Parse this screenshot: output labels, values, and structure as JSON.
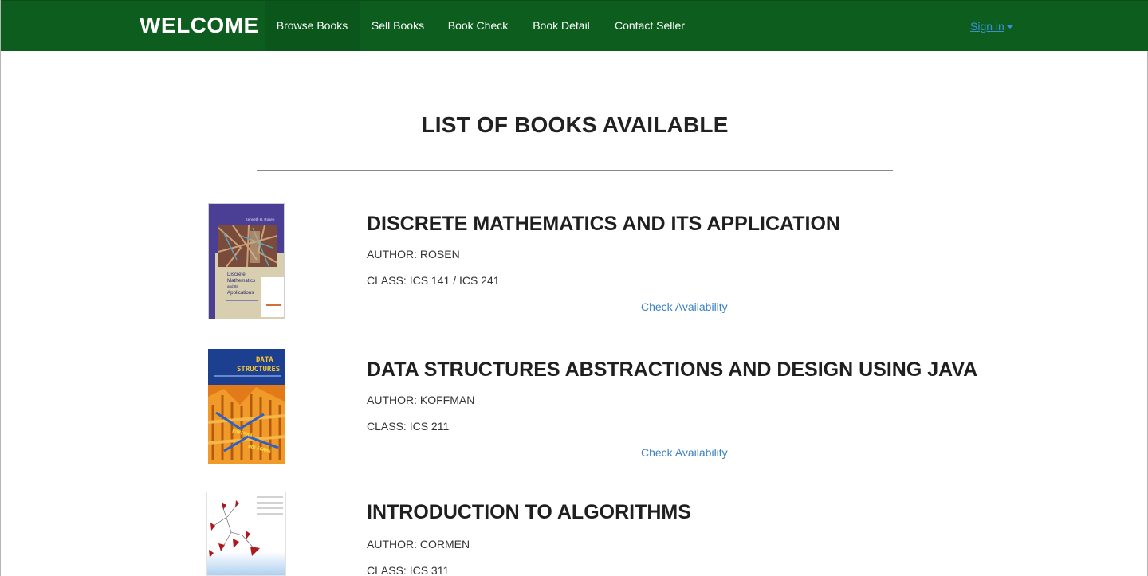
{
  "navbar": {
    "brand": "WELCOME",
    "items": [
      {
        "label": "Browse Books",
        "active": true
      },
      {
        "label": "Sell Books",
        "active": false
      },
      {
        "label": "Book Check",
        "active": false
      },
      {
        "label": "Book Detail",
        "active": false
      },
      {
        "label": "Contact Seller",
        "active": false
      }
    ],
    "signin_label": "Sign in",
    "colors": {
      "navbar_bg": "#0d5e1e",
      "link": "#3b82c4"
    }
  },
  "page": {
    "title": "LIST OF BOOKS AVAILABLE"
  },
  "books": [
    {
      "title": "DISCRETE MATHEMATICS AND ITS APPLICATION",
      "author": "AUTHOR: ROSEN",
      "class": "CLASS: ICS 141 / ICS 241",
      "link": "Check Availability",
      "cover": {
        "author_line": "Kenneth H. Rosen",
        "title_lines": [
          "Discrete",
          "Mathematics",
          "and Its",
          "Applications"
        ]
      }
    },
    {
      "title": "DATA STRUCTURES ABSTRACTIONS AND DESIGN USING JAVA",
      "author": "AUTHOR: KOFFMAN",
      "class": "CLASS: ICS 211",
      "link": "Check Availability",
      "cover": {
        "title_lines": [
          "DATA",
          "STRUCTURES"
        ],
        "authors": [
          "KOFFMAN",
          "WOLFGANG"
        ]
      }
    },
    {
      "title": "INTRODUCTION TO ALGORITHMS",
      "author": "AUTHOR: CORMEN",
      "class": "CLASS: ICS 311",
      "link": "Check Availability",
      "cover": {}
    }
  ]
}
